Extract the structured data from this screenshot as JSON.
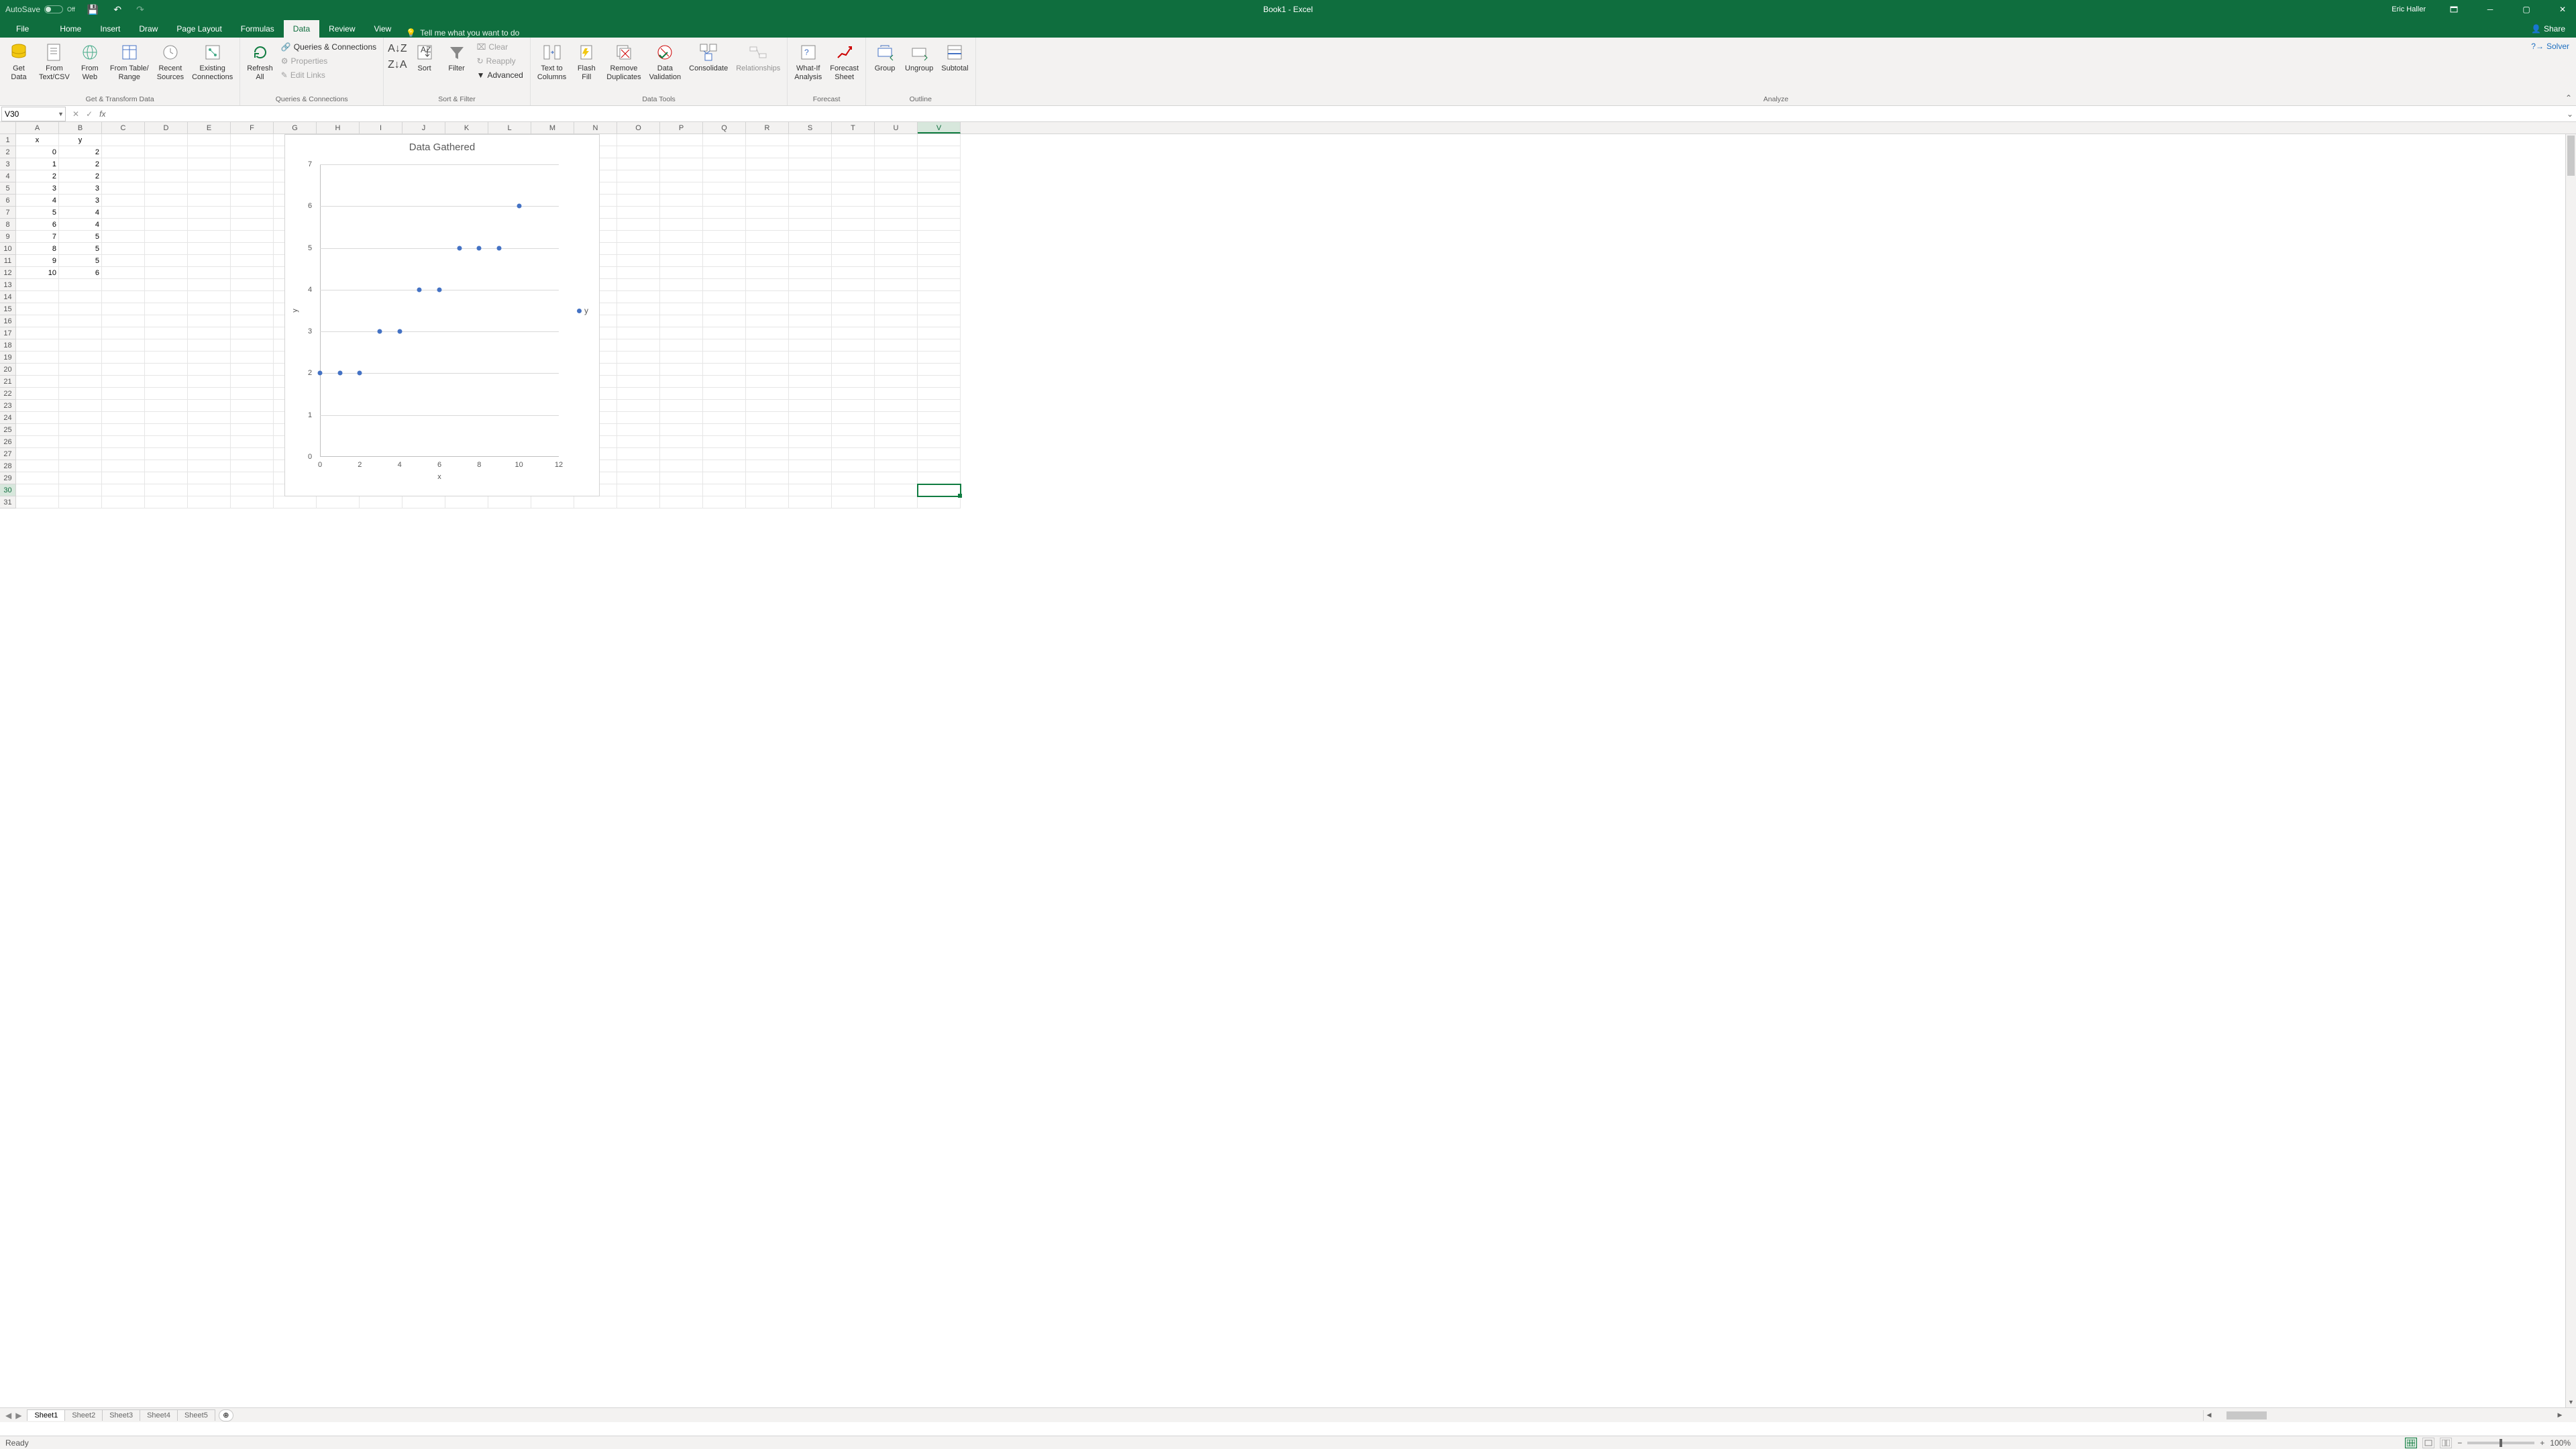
{
  "title": "Book1  -  Excel",
  "user": "Eric Haller",
  "autosave": {
    "label": "AutoSave",
    "state": "Off"
  },
  "tabs": [
    "File",
    "Home",
    "Insert",
    "Draw",
    "Page Layout",
    "Formulas",
    "Data",
    "Review",
    "View"
  ],
  "active_tab": "Data",
  "tellme": "Tell me what you want to do",
  "share": "Share",
  "ribbon": {
    "get_transform": {
      "label": "Get & Transform Data",
      "get_data": "Get\nData",
      "from_textcsv": "From\nText/CSV",
      "from_web": "From\nWeb",
      "from_table": "From Table/\nRange",
      "recent": "Recent\nSources",
      "existing": "Existing\nConnections"
    },
    "queries": {
      "label": "Queries & Connections",
      "refresh": "Refresh\nAll",
      "qc": "Queries & Connections",
      "properties": "Properties",
      "edit_links": "Edit Links"
    },
    "sortfilter": {
      "label": "Sort & Filter",
      "sort": "Sort",
      "filter": "Filter",
      "clear": "Clear",
      "reapply": "Reapply",
      "advanced": "Advanced"
    },
    "datatools": {
      "label": "Data Tools",
      "texttocolumns": "Text to\nColumns",
      "flashfill": "Flash\nFill",
      "removedup": "Remove\nDuplicates",
      "validation": "Data\nValidation",
      "consolidate": "Consolidate",
      "relationships": "Relationships"
    },
    "forecast": {
      "label": "Forecast",
      "whatif": "What-If\nAnalysis",
      "sheet": "Forecast\nSheet"
    },
    "outline": {
      "label": "Outline",
      "group": "Group",
      "ungroup": "Ungroup",
      "subtotal": "Subtotal"
    },
    "analyze": {
      "label": "Analyze",
      "solver": "Solver"
    }
  },
  "namebox": "V30",
  "formula": "",
  "columns": [
    "A",
    "B",
    "C",
    "D",
    "E",
    "F",
    "G",
    "H",
    "I",
    "J",
    "K",
    "L",
    "M",
    "N",
    "O",
    "P",
    "Q",
    "R",
    "S",
    "T",
    "U",
    "V"
  ],
  "active_col": "V",
  "active_row": 30,
  "cells": {
    "A1": "x",
    "B1": "y",
    "A2": "0",
    "B2": "2",
    "A3": "1",
    "B3": "2",
    "A4": "2",
    "B4": "2",
    "A5": "3",
    "B5": "3",
    "A6": "4",
    "B6": "3",
    "A7": "5",
    "B7": "4",
    "A8": "6",
    "B8": "4",
    "A9": "7",
    "B9": "5",
    "A10": "8",
    "B10": "5",
    "A11": "9",
    "B11": "5",
    "A12": "10",
    "B12": "6"
  },
  "sheets": [
    "Sheet1",
    "Sheet2",
    "Sheet3",
    "Sheet4",
    "Sheet5"
  ],
  "active_sheet": "Sheet1",
  "status": "Ready",
  "zoom": "100%",
  "chart_data": {
    "type": "scatter",
    "title": "Data Gathered",
    "xlabel": "x",
    "ylabel": "y",
    "xlim": [
      0,
      12
    ],
    "ylim": [
      0,
      7
    ],
    "xticks": [
      0,
      2,
      4,
      6,
      8,
      10,
      12
    ],
    "yticks": [
      0,
      1,
      2,
      3,
      4,
      5,
      6,
      7
    ],
    "series": [
      {
        "name": "y",
        "points": [
          [
            0,
            2
          ],
          [
            1,
            2
          ],
          [
            2,
            2
          ],
          [
            3,
            3
          ],
          [
            4,
            3
          ],
          [
            5,
            4
          ],
          [
            6,
            4
          ],
          [
            7,
            5
          ],
          [
            8,
            5
          ],
          [
            9,
            5
          ],
          [
            10,
            6
          ]
        ]
      }
    ]
  }
}
